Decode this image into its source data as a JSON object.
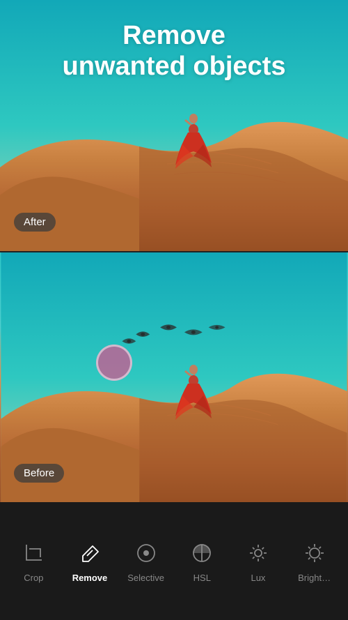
{
  "header": {
    "title_line1": "Remove",
    "title_line2": "unwanted objects"
  },
  "panels": {
    "after": {
      "label": "After"
    },
    "before": {
      "label": "Before"
    }
  },
  "toolbar": {
    "tools": [
      {
        "id": "crop",
        "label": "Crop",
        "icon": "crop",
        "active": false
      },
      {
        "id": "remove",
        "label": "Remove",
        "icon": "eraser",
        "active": true
      },
      {
        "id": "selective",
        "label": "Selective",
        "icon": "circle-dot",
        "active": false
      },
      {
        "id": "hsl",
        "label": "HSL",
        "icon": "circle-half",
        "active": false
      },
      {
        "id": "lux",
        "label": "Lux",
        "icon": "sparkle",
        "active": false
      },
      {
        "id": "brightness",
        "label": "Bright…",
        "icon": "sun",
        "active": false
      }
    ]
  },
  "colors": {
    "toolbar_bg": "#1a1a1a",
    "active_color": "#ffffff",
    "inactive_color": "#888888",
    "sky_top": "#1ab8c0",
    "sand_mid": "#c87840",
    "brush_pink": "rgba(220,80,140,0.7)"
  }
}
